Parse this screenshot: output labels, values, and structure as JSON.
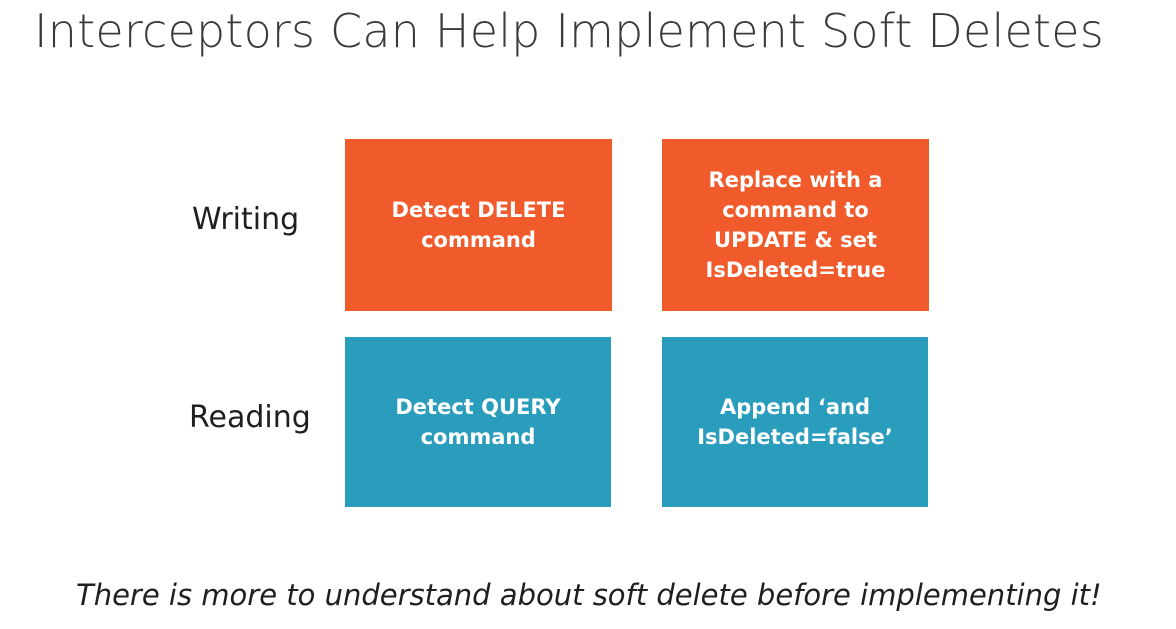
{
  "title": "Interceptors Can Help Implement Soft Deletes",
  "rows": {
    "writing": "Writing",
    "reading": "Reading"
  },
  "boxes": {
    "writing_detect": [
      "Detect DELETE",
      "command"
    ],
    "writing_replace": [
      "Replace with a",
      "command to",
      "UPDATE & set",
      "IsDeleted=true"
    ],
    "reading_detect": [
      "Detect QUERY",
      "command"
    ],
    "reading_append": [
      "Append ‘and",
      "IsDeleted=false’"
    ]
  },
  "footer": "There is more to understand about soft delete before implementing it!",
  "colors": {
    "writing_box": "#f15a2b",
    "reading_box": "#2a9dbd"
  }
}
